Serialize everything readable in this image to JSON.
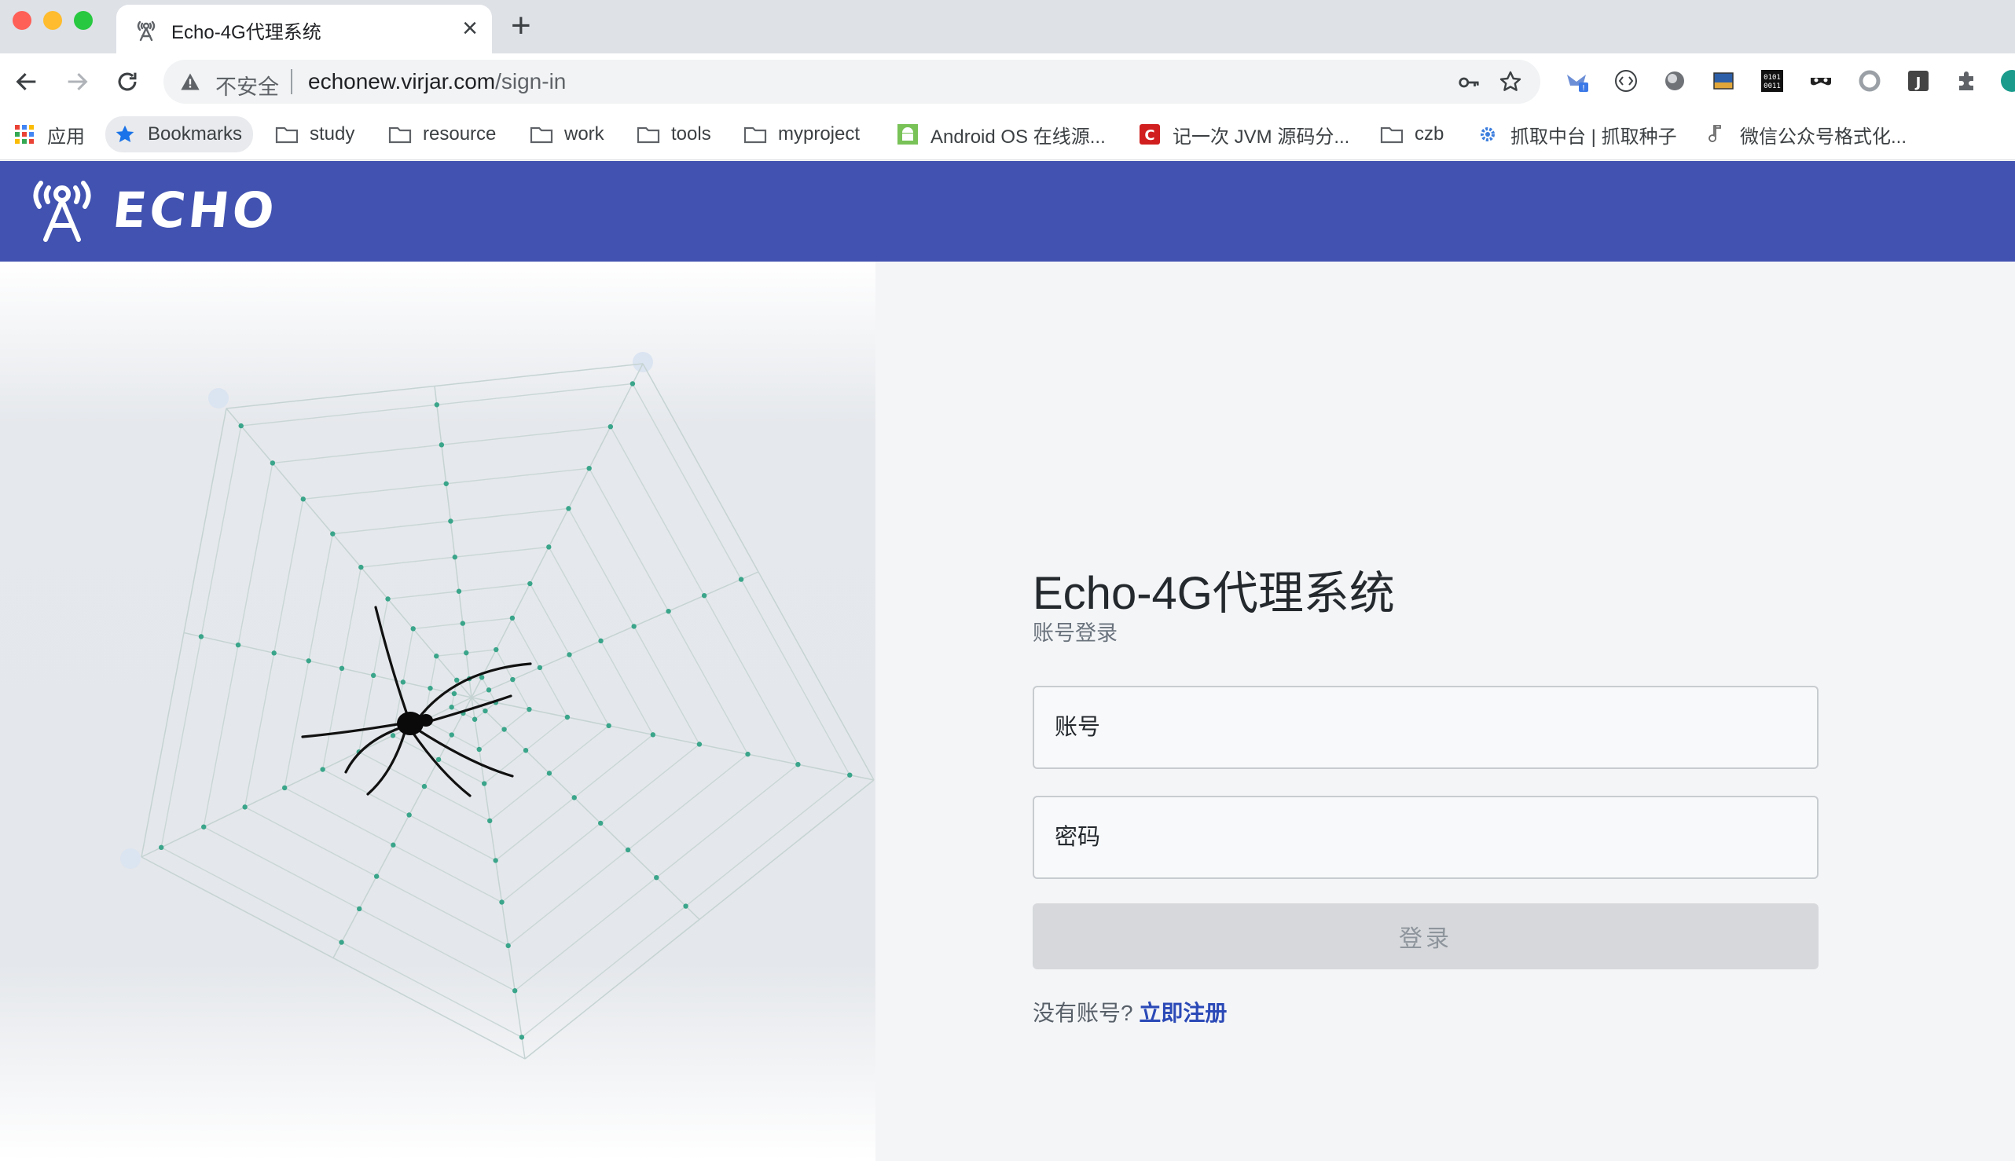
{
  "browser": {
    "tab_title": "Echo-4G代理系统",
    "tab_close": "×",
    "new_tab": "+",
    "insecure_label": "不安全",
    "url_host": "echonew.virjar.com",
    "url_path": "/sign-in"
  },
  "bookmarks": [
    {
      "label": "应用",
      "icon": "apps-grid-icon"
    },
    {
      "label": "Bookmarks",
      "icon": "star-icon"
    },
    {
      "label": "study",
      "icon": "folder-icon"
    },
    {
      "label": "resource",
      "icon": "folder-icon"
    },
    {
      "label": "work",
      "icon": "folder-icon"
    },
    {
      "label": "tools",
      "icon": "folder-icon"
    },
    {
      "label": "myproject",
      "icon": "folder-icon"
    },
    {
      "label": "Android OS 在线源...",
      "icon": "android-icon"
    },
    {
      "label": "记一次 JVM 源码分...",
      "icon": "csdn-icon"
    },
    {
      "label": "czb",
      "icon": "folder-icon"
    },
    {
      "label": "抓取中台 | 抓取种子",
      "icon": "gear-icon"
    },
    {
      "label": "微信公众号格式化...",
      "icon": "music-note-icon"
    }
  ],
  "header": {
    "logo_text": "ECHO"
  },
  "login": {
    "title": "Echo-4G代理系统",
    "subtitle": "账号登录",
    "account_placeholder": "账号",
    "password_placeholder": "密码",
    "submit_label": "登录",
    "no_account_text": "没有账号?",
    "register_link": "立即注册"
  },
  "colors": {
    "header_bg": "#4152b0",
    "link": "#2b4ab7",
    "button_disabled": "#d6d8db",
    "web_node": "#3aa58a"
  }
}
